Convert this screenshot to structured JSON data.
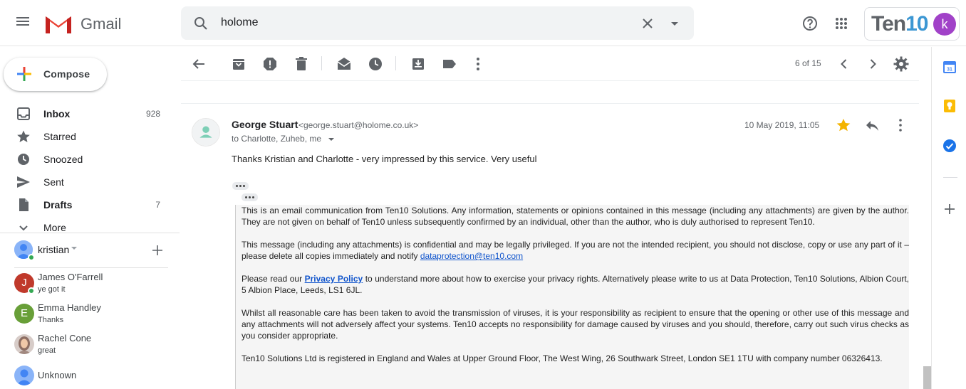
{
  "app": {
    "name": "Gmail"
  },
  "search": {
    "value": "holome"
  },
  "account": {
    "brand": "Ten10",
    "initial": "k"
  },
  "compose": {
    "label": "Compose"
  },
  "nav": [
    {
      "label": "Inbox",
      "count": "928",
      "bold": true
    },
    {
      "label": "Starred",
      "count": ""
    },
    {
      "label": "Snoozed",
      "count": ""
    },
    {
      "label": "Sent",
      "count": ""
    },
    {
      "label": "Drafts",
      "count": "7",
      "bold": true
    },
    {
      "label": "More",
      "count": ""
    }
  ],
  "hangouts": {
    "me": "kristian",
    "contacts": [
      {
        "name": "James O'Farrell",
        "status": "ye got it",
        "initial": "J",
        "color": "#c0392b"
      },
      {
        "name": "Emma Handley",
        "status": "Thanks",
        "initial": "E",
        "color": "#689f38"
      },
      {
        "name": "Rachel Cone",
        "status": "great",
        "initial": "",
        "color": "#8d6e63"
      },
      {
        "name": "Unknown",
        "status": "",
        "initial": "",
        "color": "#8ab4f8"
      }
    ]
  },
  "toolbar": {
    "pager": "6 of 15"
  },
  "message": {
    "sender_name": "George Stuart",
    "sender_email": "<george.stuart@holome.co.uk>",
    "recipients": "to Charlotte, Zuheb, me",
    "date": "10 May 2019, 11:05",
    "body": "Thanks Kristian and Charlotte - very impressed by this service. Very useful"
  },
  "quote": {
    "p1": "This is an email communication from Ten10 Solutions. Any information, statements or opinions contained in this message (including any attachments) are given by the author. They are not given on behalf of Ten10 unless subsequently confirmed by an individual, other than the author, who is duly authorised to represent Ten10.",
    "p2_pre": "This message (including any attachments) is confidential and may be legally privileged. If you are not the intended recipient, you should not disclose, copy or use any part of it – please delete all copies immediately and notify ",
    "p2_link": "dataprotection@ten10.com",
    "p3_pre": "Please read our ",
    "p3_link": "Privacy Policy",
    "p3_post": " to understand more about how to exercise your privacy rights. Alternatively please write to us at Data Protection, Ten10 Solutions, Albion Court, 5 Albion Place, Leeds, LS1 6JL.",
    "p4": "Whilst all reasonable care has been taken to avoid the transmission of viruses, it is your responsibility as recipient to ensure that the opening or other use of this message and any attachments will not adversely affect your systems. Ten10 accepts no responsibility for damage caused by viruses and you should, therefore, carry out such virus checks as you consider appropriate.",
    "p5": "Ten10 Solutions Ltd is registered in England and Wales at Upper Ground Floor, The West Wing, 26 Southwark Street, London SE1 1TU with company number 06326413."
  },
  "colors": {
    "accent": "#1a73e8",
    "star": "#f4b400",
    "avatar_k": "#a142c8",
    "brand_blue": "#3c97d3"
  }
}
